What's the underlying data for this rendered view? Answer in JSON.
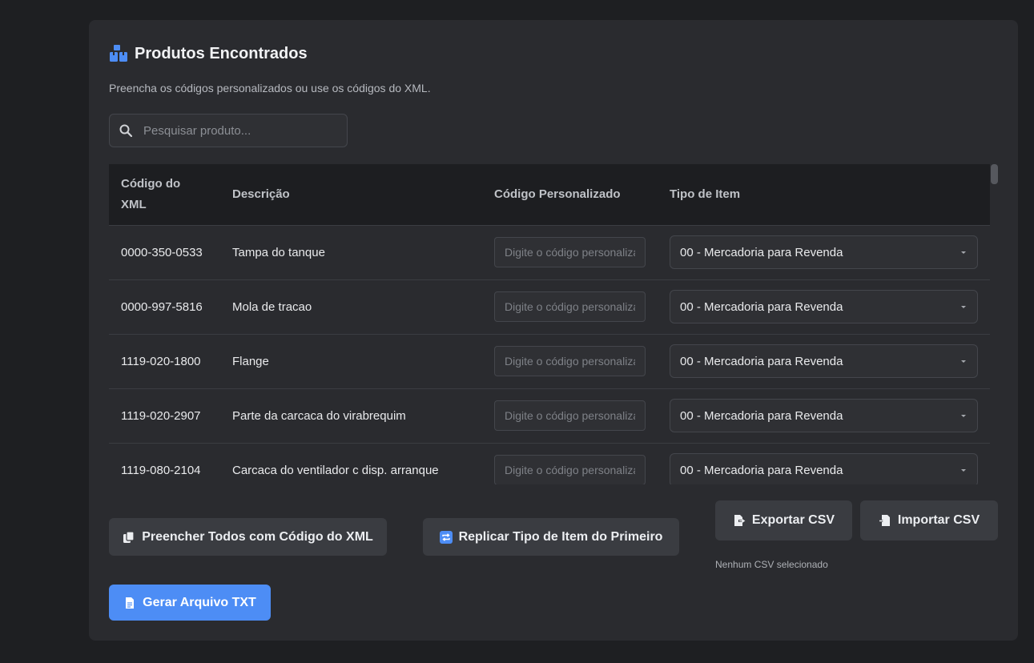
{
  "panel": {
    "title": "Produtos Encontrados",
    "subtitle": "Preencha os códigos personalizados ou use os códigos do XML.",
    "title_icon": "boxes-icon",
    "accent_color": "#4d8df5"
  },
  "search": {
    "placeholder": "Pesquisar produto...",
    "value": ""
  },
  "table": {
    "headers": {
      "code_xml": "Código do XML",
      "description": "Descrição",
      "custom_code": "Código Personalizado",
      "item_type": "Tipo de Item"
    },
    "custom_code_placeholder": "Digite o código personalizado",
    "rows": [
      {
        "code": "0000-350-0533",
        "description": "Tampa do tanque",
        "custom_code": "",
        "item_type": "00 - Mercadoria para Revenda"
      },
      {
        "code": "0000-997-5816",
        "description": "Mola de tracao",
        "custom_code": "",
        "item_type": "00 - Mercadoria para Revenda"
      },
      {
        "code": "1119-020-1800",
        "description": "Flange",
        "custom_code": "",
        "item_type": "00 - Mercadoria para Revenda"
      },
      {
        "code": "1119-020-2907",
        "description": "Parte da carcaca do virabrequim",
        "custom_code": "",
        "item_type": "00 - Mercadoria para Revenda"
      },
      {
        "code": "1119-080-2104",
        "description": "Carcaca do ventilador c disp. arranque",
        "custom_code": "",
        "item_type": "00 - Mercadoria para Revenda"
      }
    ]
  },
  "actions": {
    "fill_all": "Preencher Todos com Código do XML",
    "replicate": "Replicar Tipo de Item do Primeiro",
    "export_csv": "Exportar CSV",
    "import_csv": "Importar CSV",
    "csv_status": "Nenhum CSV selecionado",
    "generate_txt": "Gerar Arquivo TXT"
  }
}
